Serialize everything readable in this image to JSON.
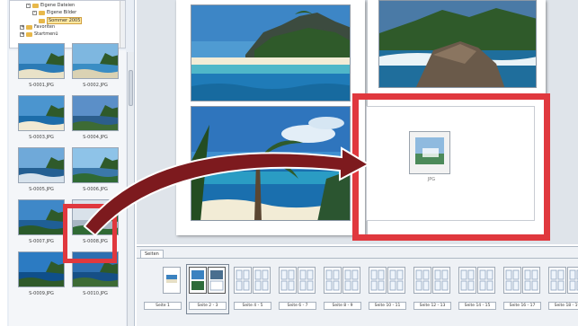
{
  "tree": {
    "items": [
      {
        "label": "Eigene Dateien",
        "indent": 2,
        "expander": "-"
      },
      {
        "label": "Eigene Bilder",
        "indent": 3,
        "expander": "-"
      },
      {
        "label": "Sommer 2005",
        "indent": 4,
        "expander": "",
        "selected": true
      },
      {
        "label": "Favoriten",
        "indent": 1,
        "expander": "+"
      },
      {
        "label": "Startmenü",
        "indent": 1,
        "expander": "+"
      }
    ]
  },
  "thumbnails": [
    {
      "caption": "S-0001.JPG"
    },
    {
      "caption": "S-0002.JPG"
    },
    {
      "caption": "S-0003.JPG"
    },
    {
      "caption": "S-0004.JPG"
    },
    {
      "caption": "S-0005.JPG"
    },
    {
      "caption": "S-0006.JPG"
    },
    {
      "caption": "S-0007.JPG"
    },
    {
      "caption": "S-0008.JPG"
    },
    {
      "caption": "S-0009.JPG"
    },
    {
      "caption": "S-0010.JPG"
    }
  ],
  "ghost": {
    "label": "JPG"
  },
  "strip": {
    "tab_label": "Seiten",
    "spreads": [
      {
        "label": "Seite 1",
        "single": true,
        "filled": true
      },
      {
        "label": "Seite 2 - 3",
        "filled": true,
        "active": true
      },
      {
        "label": "Seite 4 - 5"
      },
      {
        "label": "Seite 6 - 7"
      },
      {
        "label": "Seite 8 - 9"
      },
      {
        "label": "Seite 10 - 11"
      },
      {
        "label": "Seite 12 - 13"
      },
      {
        "label": "Seite 14 - 15"
      },
      {
        "label": "Seite 16 - 17"
      },
      {
        "label": "Seite 18 - 19"
      }
    ]
  },
  "colors": {
    "highlight": "#e0383e",
    "arrow": "#7d1a1e",
    "sky": "#4f9bd2",
    "sea": "#1f7bb8",
    "sand": "#f2ecd6",
    "foliage": "#2f5a2a"
  }
}
